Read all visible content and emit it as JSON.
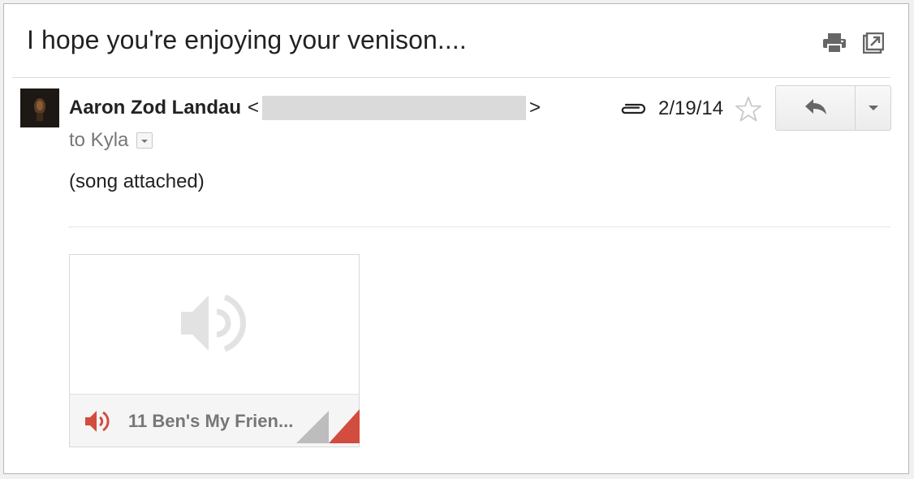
{
  "email": {
    "subject": "I hope you're enjoying your venison....",
    "sender_name": "Aaron Zod Landau",
    "sender_open": "<",
    "sender_close": ">",
    "recipient_label": "to Kyla",
    "date": "2/19/14",
    "body": "(song attached)"
  },
  "attachment": {
    "file_name": "11 Ben's My Frien...",
    "icon": "audio-speaker-icon"
  },
  "toolbar": {
    "print_icon": "print-icon",
    "new_window_icon": "open-in-new-window-icon",
    "reply_icon": "reply-arrow-icon",
    "more_icon": "dropdown-caret-icon",
    "star_icon": "star-outline-icon",
    "attachment_icon": "paperclip-icon"
  },
  "colors": {
    "accent_red": "#d24c3f",
    "muted_text": "#777777",
    "redaction": "#dadada"
  }
}
